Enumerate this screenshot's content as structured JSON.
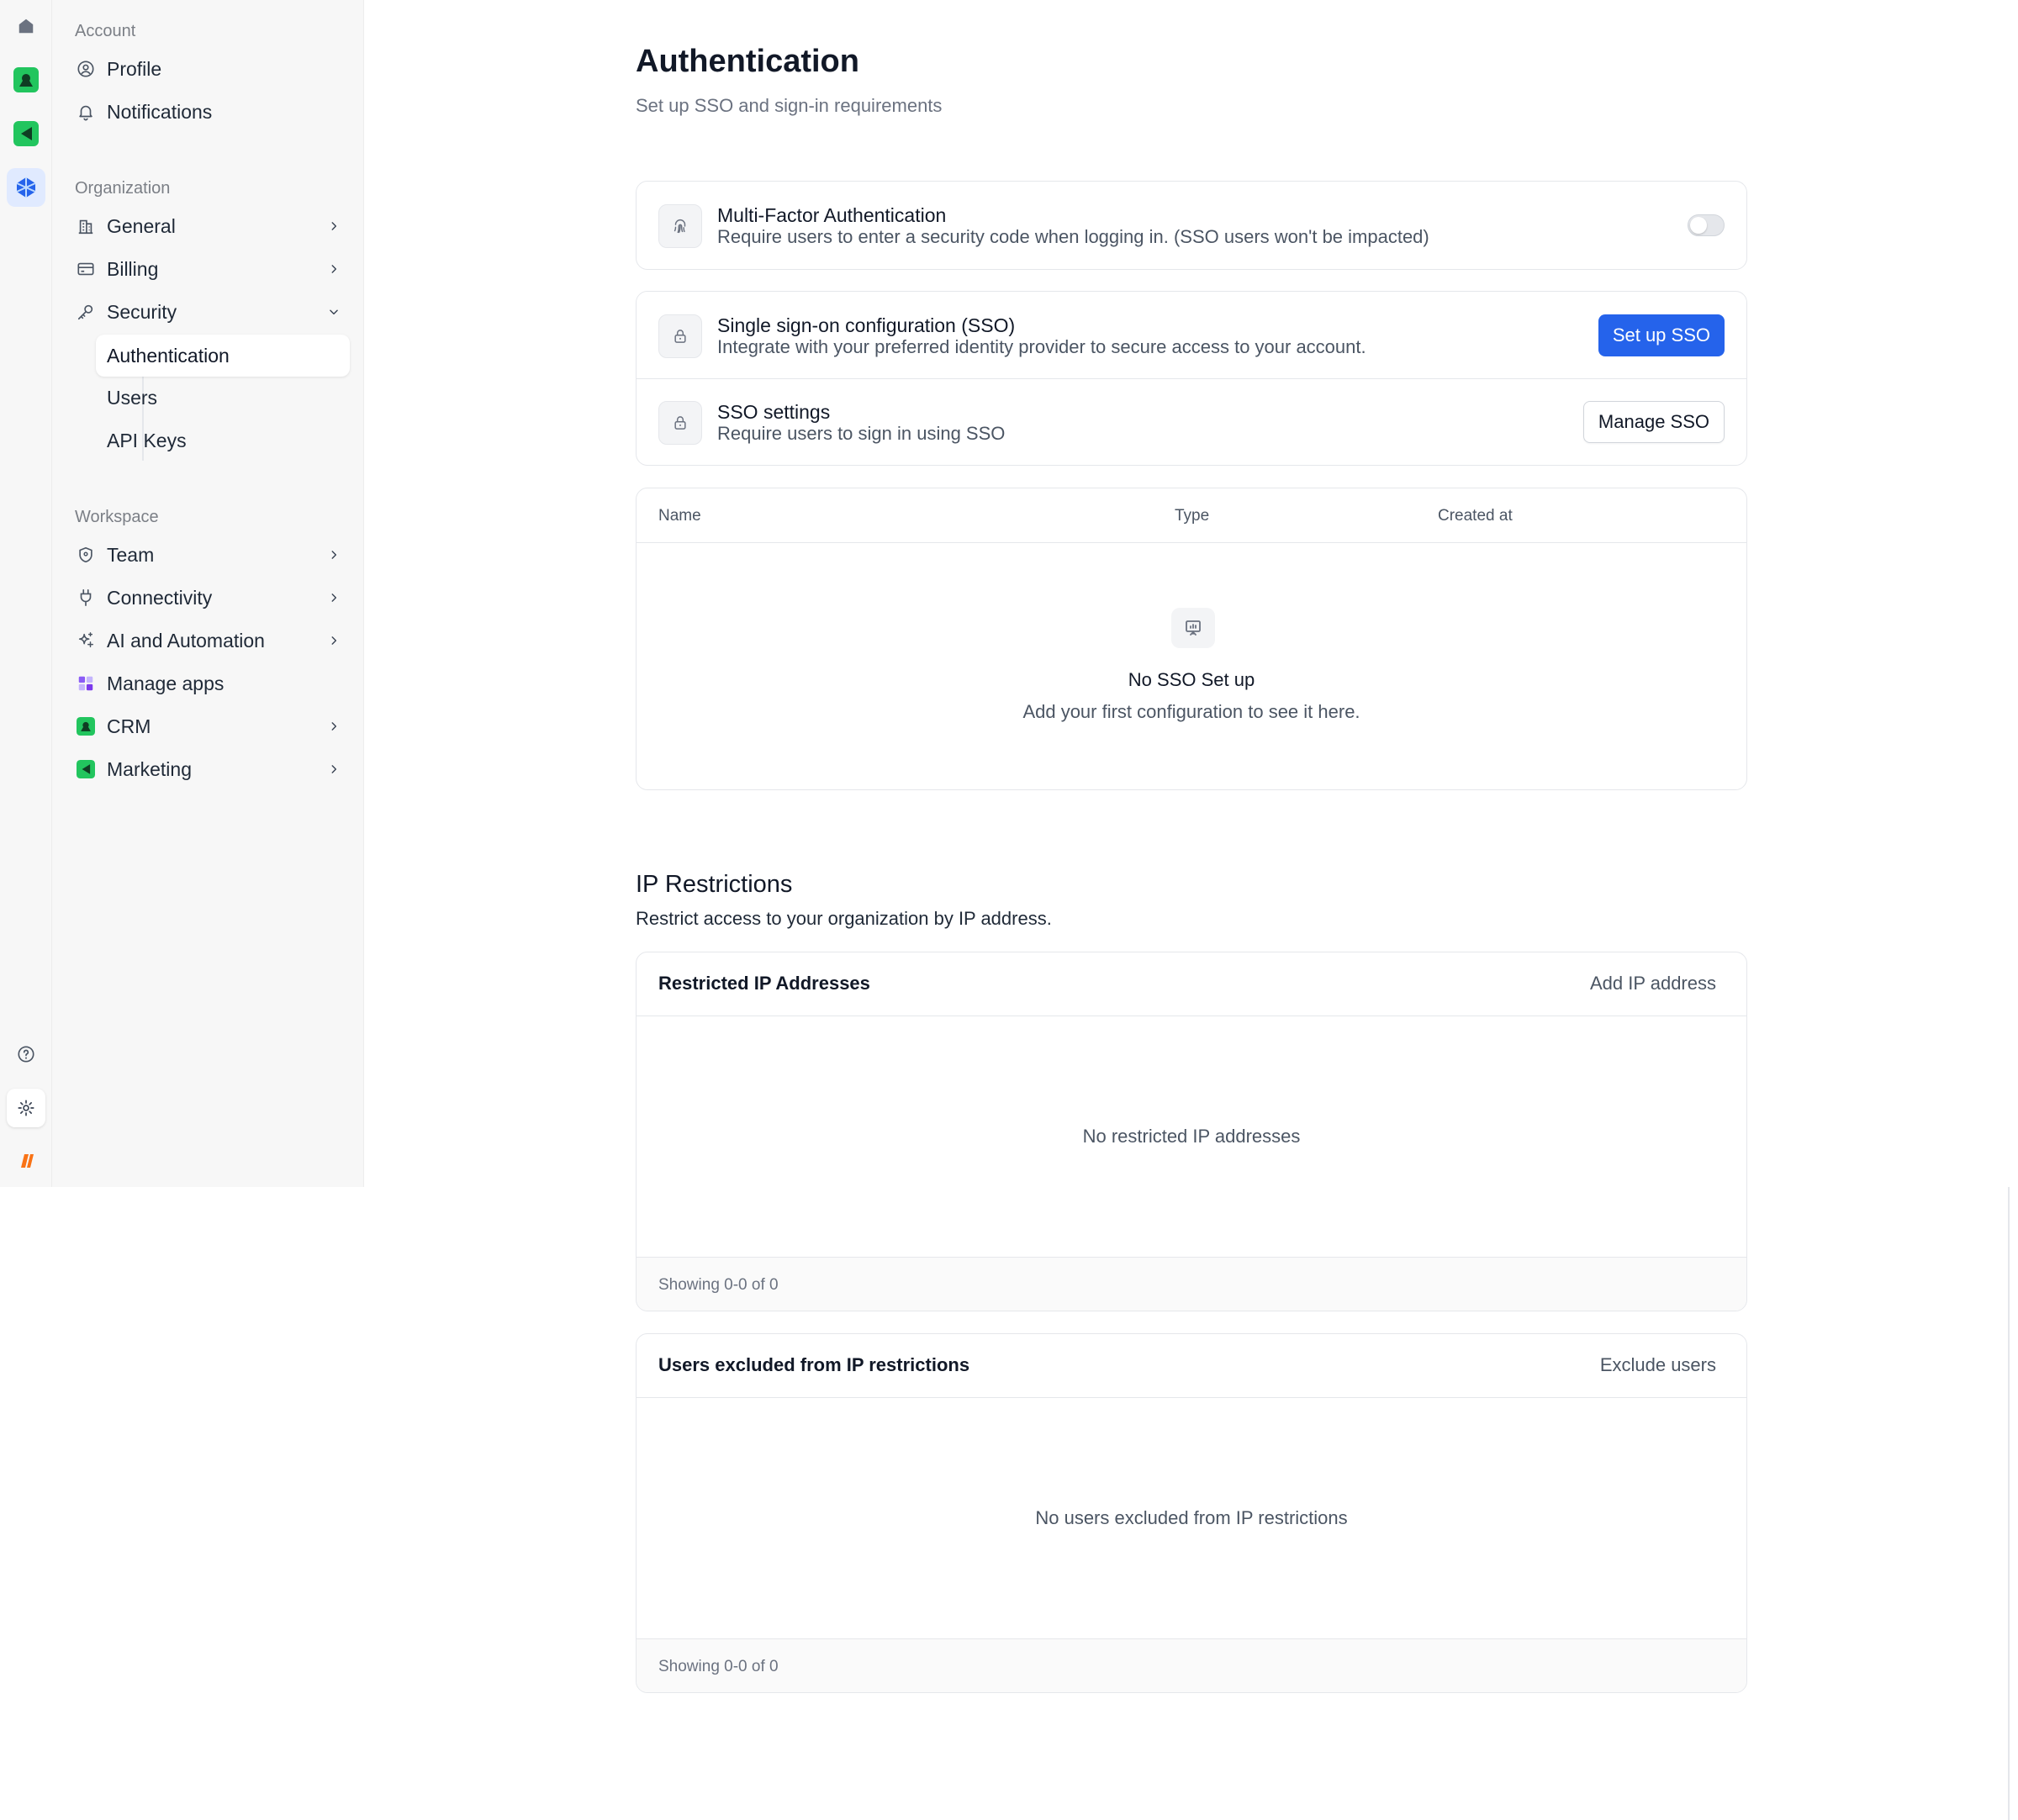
{
  "colors": {
    "accent": "#2563eb",
    "brand_orange": "#f97316",
    "crm_green": "#22c55e",
    "apps_purple": "#8b5cf6"
  },
  "rail": {
    "items": [
      {
        "icon": "home-icon"
      },
      {
        "icon": "crm-app-icon"
      },
      {
        "icon": "marketing-app-icon"
      },
      {
        "icon": "workspace-app-icon"
      },
      {
        "icon": "help-icon"
      },
      {
        "icon": "settings-icon"
      },
      {
        "icon": "brand-logo-icon"
      }
    ]
  },
  "sidebar": {
    "account": {
      "label": "Account",
      "items": [
        {
          "label": "Profile",
          "icon": "user-circle-icon"
        },
        {
          "label": "Notifications",
          "icon": "bell-icon"
        }
      ]
    },
    "organization": {
      "label": "Organization",
      "items": [
        {
          "label": "General",
          "icon": "building-icon"
        },
        {
          "label": "Billing",
          "icon": "credit-card-icon"
        },
        {
          "label": "Security",
          "icon": "key-icon"
        }
      ],
      "security_sub": [
        {
          "label": "Authentication"
        },
        {
          "label": "Users"
        },
        {
          "label": "API Keys"
        }
      ]
    },
    "workspace": {
      "label": "Workspace",
      "items": [
        {
          "label": "Team",
          "icon": "shield-icon"
        },
        {
          "label": "Connectivity",
          "icon": "plug-icon"
        },
        {
          "label": "AI and Automation",
          "icon": "sparkle-icon"
        },
        {
          "label": "Manage apps",
          "icon": "apps-icon"
        },
        {
          "label": "CRM",
          "icon": "crm-icon"
        },
        {
          "label": "Marketing",
          "icon": "marketing-icon"
        }
      ]
    }
  },
  "main": {
    "title": "Authentication",
    "subtitle": "Set up SSO and sign-in requirements",
    "mfa": {
      "title": "Multi-Factor Authentication",
      "desc": "Require users to enter a security code when logging in. (SSO users won't be impacted)",
      "enabled": false
    },
    "sso": {
      "config_title": "Single sign-on configuration (SSO)",
      "config_desc": "Integrate with your preferred identity provider to secure access to your account.",
      "setup_button": "Set up SSO",
      "settings_title": "SSO settings",
      "settings_desc": "Require users to sign in using SSO",
      "manage_button": "Manage SSO"
    },
    "sso_table": {
      "columns": [
        "Name",
        "Type",
        "Created at"
      ],
      "empty_title": "No SSO Set up",
      "empty_desc": "Add your first configuration to see it here."
    },
    "ip": {
      "title": "IP Restrictions",
      "desc": "Restrict access to your organization by IP address.",
      "restricted": {
        "title": "Restricted IP Addresses",
        "action": "Add IP address",
        "empty": "No restricted IP addresses",
        "footer": "Showing 0-0 of 0"
      },
      "excluded": {
        "title": "Users excluded from IP restrictions",
        "action": "Exclude users",
        "empty": "No users excluded from IP restrictions",
        "footer": "Showing 0-0 of 0"
      }
    }
  }
}
